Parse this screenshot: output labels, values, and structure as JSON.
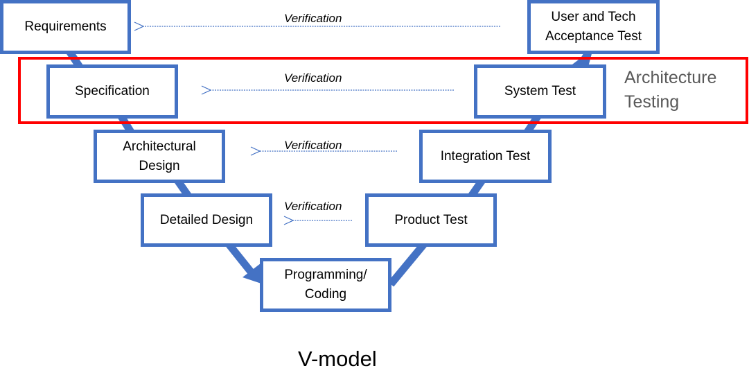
{
  "title": "V-model",
  "highlight_group": {
    "label": "Architecture\nTesting",
    "border_color": "#ff0000",
    "label_color": "#595959"
  },
  "colors": {
    "box_border": "#4472c4",
    "connector": "#4472c4",
    "verification_arrow": "#4472c4"
  },
  "left_phases": [
    {
      "id": "requirements",
      "label": "Requirements"
    },
    {
      "id": "specification",
      "label": "Specification"
    },
    {
      "id": "architectural-design",
      "label": "Architectural\nDesign"
    },
    {
      "id": "detailed-design",
      "label": "Detailed Design"
    }
  ],
  "bottom_phase": {
    "id": "programming-coding",
    "label": "Programming/\nCoding"
  },
  "right_phases": [
    {
      "id": "product-test",
      "label": "Product Test"
    },
    {
      "id": "integration-test",
      "label": "Integration Test"
    },
    {
      "id": "system-test",
      "label": "System Test"
    },
    {
      "id": "user-tech-acceptance-test",
      "label": "User and Tech\nAcceptance Test"
    }
  ],
  "verifications": [
    {
      "from": "user-tech-acceptance-test",
      "to": "requirements",
      "label": "Verification"
    },
    {
      "from": "system-test",
      "to": "specification",
      "label": "Verification"
    },
    {
      "from": "integration-test",
      "to": "architectural-design",
      "label": "Verification"
    },
    {
      "from": "product-test",
      "to": "detailed-design",
      "label": "Verification"
    }
  ]
}
